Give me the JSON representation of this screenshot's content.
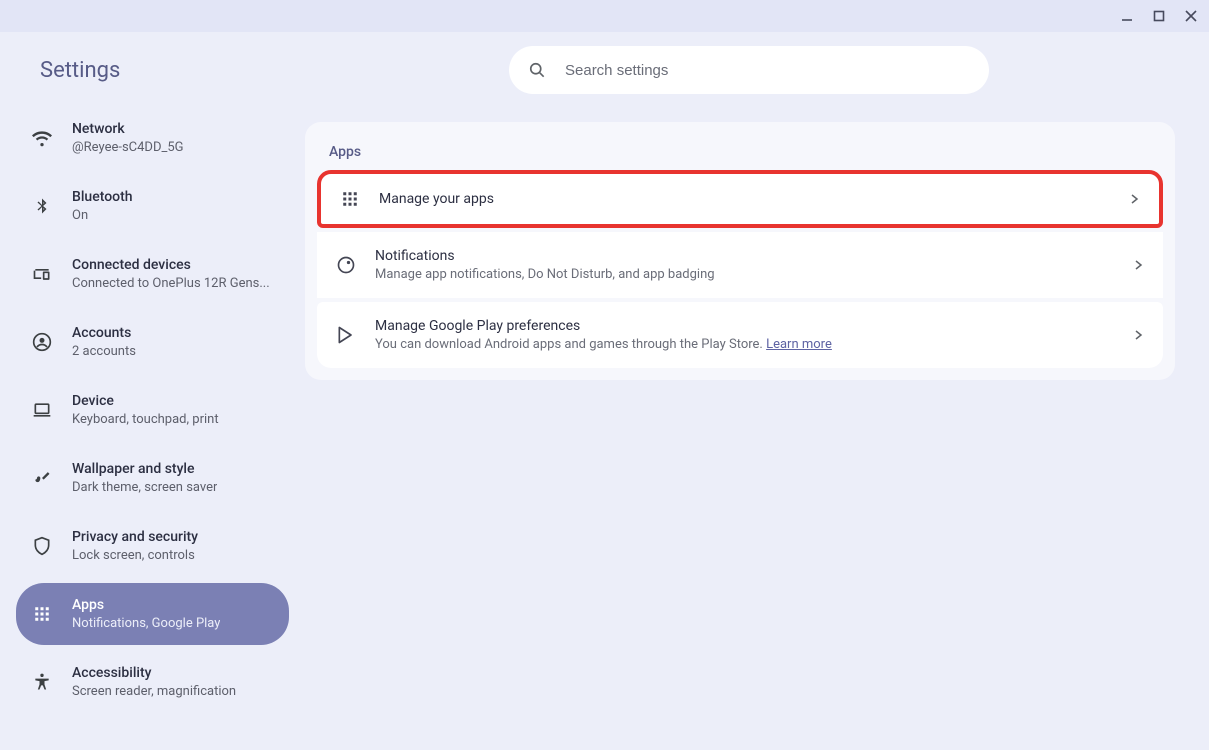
{
  "appTitle": "Settings",
  "search": {
    "placeholder": "Search settings"
  },
  "sidebar": [
    {
      "label": "Network",
      "sublabel": "@Reyee-sC4DD_5G"
    },
    {
      "label": "Bluetooth",
      "sublabel": "On"
    },
    {
      "label": "Connected devices",
      "sublabel": "Connected to OnePlus 12R Gens..."
    },
    {
      "label": "Accounts",
      "sublabel": "2 accounts"
    },
    {
      "label": "Device",
      "sublabel": "Keyboard, touchpad, print"
    },
    {
      "label": "Wallpaper and style",
      "sublabel": "Dark theme, screen saver"
    },
    {
      "label": "Privacy and security",
      "sublabel": "Lock screen, controls"
    },
    {
      "label": "Apps",
      "sublabel": "Notifications, Google Play"
    },
    {
      "label": "Accessibility",
      "sublabel": "Screen reader, magnification"
    }
  ],
  "section": {
    "title": "Apps",
    "rows": [
      {
        "title": "Manage your apps",
        "sub": ""
      },
      {
        "title": "Notifications",
        "sub": "Manage app notifications, Do Not Disturb, and app badging"
      },
      {
        "title": "Manage Google Play preferences",
        "sub": "You can download Android apps and games through the Play Store. ",
        "link": "Learn more"
      }
    ]
  }
}
